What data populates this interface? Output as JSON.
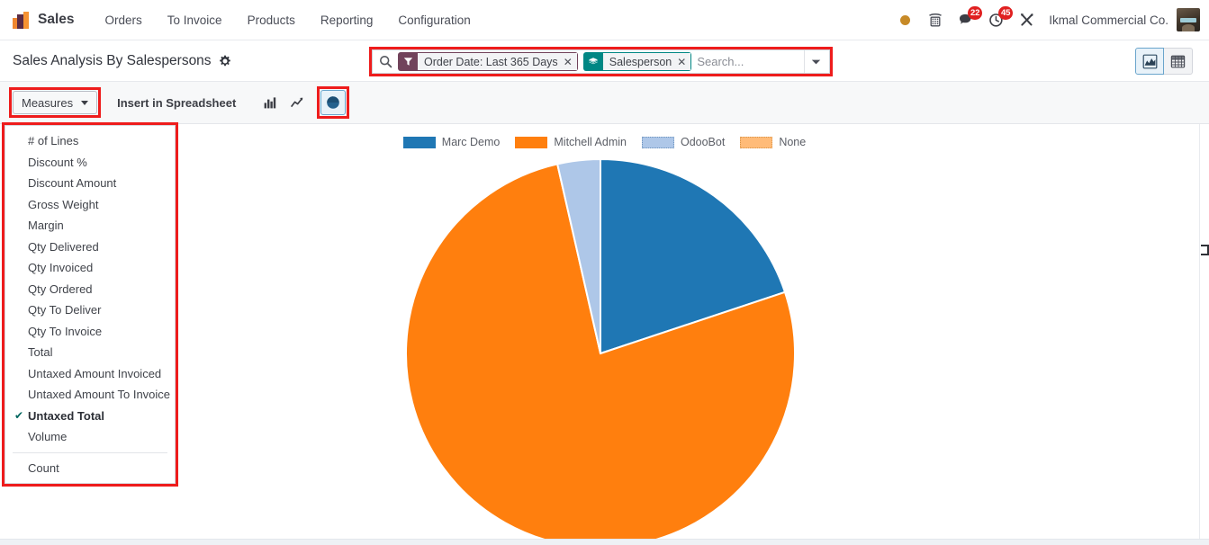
{
  "navbar": {
    "app_name": "Sales",
    "logo_icon": "odoo-sales-logo-icon",
    "menu": [
      {
        "label": "Orders"
      },
      {
        "label": "To Invoice"
      },
      {
        "label": "Products"
      },
      {
        "label": "Reporting"
      },
      {
        "label": "Configuration"
      }
    ],
    "systray": {
      "presence_icon": "amber-dot-icon",
      "voip_icon": "phone-keypad-icon",
      "messaging_icon": "chat-bubble-icon",
      "messaging_count": "22",
      "activities_icon": "clock-icon",
      "activities_count": "45",
      "tools_icon": "wrench-screwdriver-icon",
      "company_name": "Ikmal Commercial Co.",
      "avatar_icon": "user-avatar"
    }
  },
  "control_panel": {
    "page_title": "Sales Analysis By Salespersons",
    "gear_icon": "gear-icon",
    "search": {
      "magnifier_icon": "search-icon",
      "placeholder": "Search...",
      "value": "",
      "caret_icon": "chevron-down-icon",
      "facets": [
        {
          "type": "filter",
          "icon": "filter-funnel-icon",
          "label": "Order Date: Last 365 Days",
          "remove_icon": "close-icon",
          "color": "#71435b"
        },
        {
          "type": "groupby",
          "icon": "layers-stack-icon",
          "label": "Salesperson",
          "remove_icon": "close-icon",
          "color": "#008784"
        }
      ]
    },
    "view_switcher": [
      {
        "name": "graph",
        "icon": "area-chart-icon",
        "active": true
      },
      {
        "name": "pivot",
        "icon": "pivot-table-icon",
        "active": false
      }
    ]
  },
  "toolbar": {
    "measures_label": "Measures",
    "measures_caret_icon": "caret-down-icon",
    "insert_spreadsheet_label": "Insert in Spreadsheet",
    "chart_types": [
      {
        "name": "bar",
        "icon": "bar-chart-icon",
        "active": false
      },
      {
        "name": "line",
        "icon": "line-chart-icon",
        "active": false
      },
      {
        "name": "pie",
        "icon": "pie-chart-icon",
        "active": true
      }
    ]
  },
  "measures_dropdown": {
    "open": true,
    "check_icon": "checkmark-icon",
    "items": [
      {
        "label": "# of Lines",
        "selected": false
      },
      {
        "label": "Discount %",
        "selected": false
      },
      {
        "label": "Discount Amount",
        "selected": false
      },
      {
        "label": "Gross Weight",
        "selected": false
      },
      {
        "label": "Margin",
        "selected": false
      },
      {
        "label": "Qty Delivered",
        "selected": false
      },
      {
        "label": "Qty Invoiced",
        "selected": false
      },
      {
        "label": "Qty Ordered",
        "selected": false
      },
      {
        "label": "Qty To Deliver",
        "selected": false
      },
      {
        "label": "Qty To Invoice",
        "selected": false
      },
      {
        "label": "Total",
        "selected": false
      },
      {
        "label": "Untaxed Amount Invoiced",
        "selected": false
      },
      {
        "label": "Untaxed Amount To Invoice",
        "selected": false
      },
      {
        "label": "Untaxed Total",
        "selected": true
      },
      {
        "label": "Volume",
        "selected": false
      }
    ],
    "footer_items": [
      {
        "label": "Count",
        "selected": false
      }
    ]
  },
  "chart_data": {
    "type": "pie",
    "title": "",
    "subtitle": "",
    "xlabel": "",
    "ylabel": "",
    "measure": "Untaxed Total",
    "groupby": "Salesperson",
    "legend_position": "top",
    "grid": false,
    "labels": [
      "Marc Demo",
      "Mitchell Admin",
      "OdooBot",
      "None"
    ],
    "values": [
      19.9,
      76.5,
      3.6,
      0
    ],
    "unit": "percent",
    "colors": [
      "#1f77b4",
      "#ff7f0e",
      "#aec7e8",
      "#ffbb78"
    ],
    "slices": [
      {
        "label": "Marc Demo",
        "percent": 19.9,
        "color": "#1f77b4",
        "start_angle": 0,
        "end_angle": 71.6,
        "dashed_border": false
      },
      {
        "label": "Mitchell Admin",
        "percent": 76.5,
        "color": "#ff7f0e",
        "start_angle": 71.6,
        "end_angle": 347.2,
        "dashed_border": false
      },
      {
        "label": "OdooBot",
        "percent": 3.6,
        "color": "#aec7e8",
        "start_angle": 347.2,
        "end_angle": 360,
        "dashed_border": false
      },
      {
        "label": "None",
        "percent": 0,
        "color": "#ffbb78",
        "start_angle": 360,
        "end_angle": 360,
        "dashed_border": true
      }
    ]
  },
  "accents": {
    "highlight_box": "#ee1c1c",
    "brand_purple": "#71435b",
    "brand_teal": "#008784",
    "badge_red": "#e02020",
    "active_blue_bg": "#e8f2f9",
    "active_blue_border": "#6aa5cc"
  }
}
